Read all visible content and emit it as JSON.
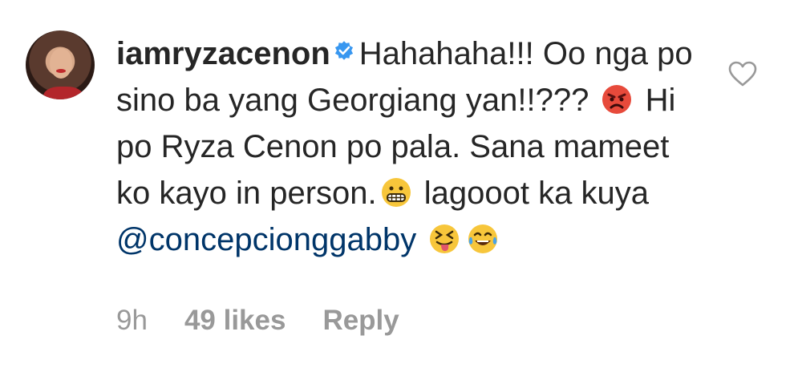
{
  "comment": {
    "username": "iamryzacenon",
    "verified": true,
    "text_segments": [
      "Hahahaha!!! Oo nga po sino ba yang Georgiang yan!!???",
      "Hi po Ryza Cenon po pala. Sana mameet ko kayo in person.",
      "lagooot ka kuya"
    ],
    "mention": "@concepcionggabby",
    "emojis": [
      "angry-face-emoji",
      "grimacing-face-emoji",
      "squinting-tongue-face-emoji",
      "tears-of-joy-emoji"
    ]
  },
  "meta": {
    "time": "9h",
    "likes": "49 likes",
    "reply": "Reply"
  },
  "colors": {
    "text": "#262626",
    "mention": "#003569",
    "meta": "#999999"
  },
  "icons": {
    "verified": "verified-badge-icon",
    "like": "heart-outline-icon",
    "avatar": "profile-avatar"
  }
}
